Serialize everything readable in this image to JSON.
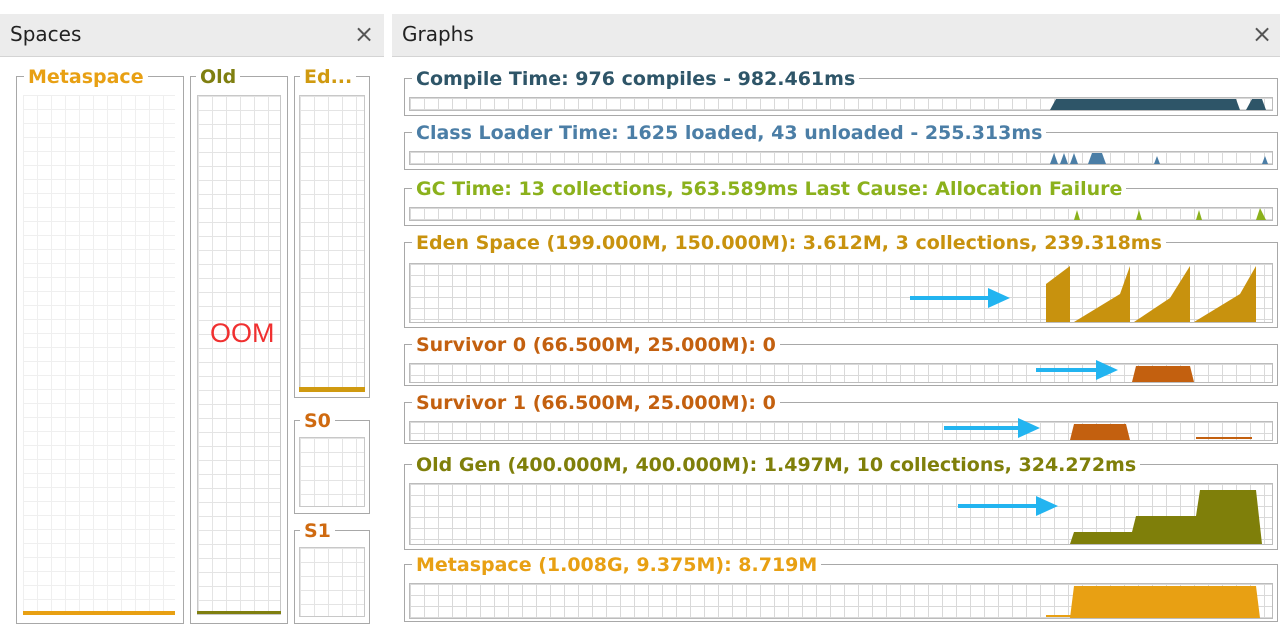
{
  "tabs": {
    "spaces": {
      "title": "Spaces",
      "close": "×"
    },
    "graphs": {
      "title": "Graphs",
      "close": "×"
    }
  },
  "spaces": {
    "metaspace": {
      "label": "Metaspace",
      "color": "#e8a013"
    },
    "old": {
      "label": "Old",
      "color": "#7f7f10"
    },
    "eden": {
      "label": "Ed...",
      "color": "#d09a10"
    },
    "s0": {
      "label": "S0",
      "color": "#cf6a10"
    },
    "s1": {
      "label": "S1",
      "color": "#cf6a10"
    },
    "annotation": "OOM"
  },
  "graphs": [
    {
      "key": "compile",
      "label": "Compile Time: 976 compiles - 982.461ms",
      "color": "#2e5568"
    },
    {
      "key": "classloader",
      "label": "Class Loader Time: 1625 loaded, 43 unloaded - 255.313ms",
      "color": "#4b7ea6"
    },
    {
      "key": "gc",
      "label": "GC Time: 13 collections, 563.589ms Last Cause: Allocation Failure",
      "color": "#8bb11c"
    },
    {
      "key": "eden",
      "label": "Eden Space (199.000M, 150.000M): 3.612M, 3 collections, 239.318ms",
      "color": "#c8920e"
    },
    {
      "key": "s0",
      "label": "Survivor 0 (66.500M, 25.000M): 0",
      "color": "#c3600f"
    },
    {
      "key": "s1",
      "label": "Survivor 1 (66.500M, 25.000M): 0",
      "color": "#c3600f"
    },
    {
      "key": "oldgen",
      "label": "Old Gen (400.000M, 400.000M): 1.497M, 10 collections, 324.272ms",
      "color": "#7f7f0a"
    },
    {
      "key": "metaspace",
      "label": "Metaspace (1.008G, 9.375M): 8.719M",
      "color": "#e8a013"
    }
  ],
  "annotation_arrow_color": "#22b4f0"
}
